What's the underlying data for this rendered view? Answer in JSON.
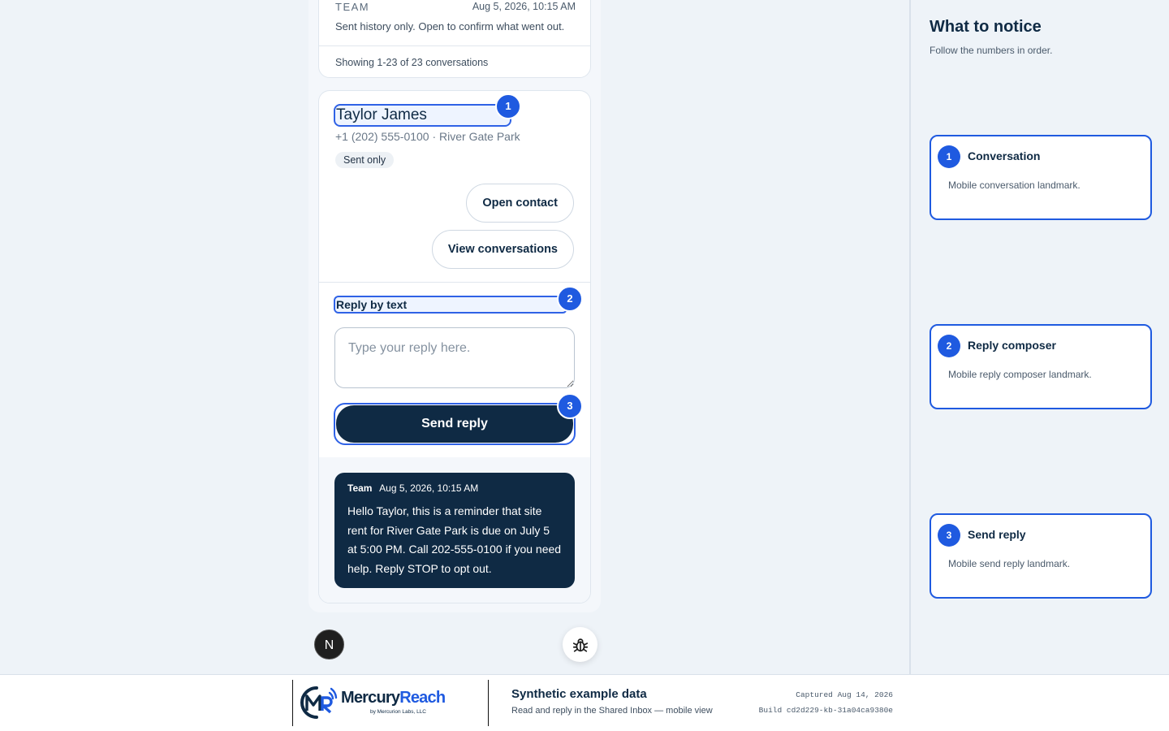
{
  "top_card": {
    "sender": "TEAM",
    "timestamp": "Aug 5, 2026, 10:15 AM",
    "preview": "Sent history only. Open to confirm what went out.",
    "count_text": "Showing 1-23 of 23 conversations"
  },
  "conversation": {
    "contact_name": "Taylor James",
    "contact_meta": "+1 (202) 555-0100 · River Gate Park",
    "status_pill": "Sent only",
    "open_contact_label": "Open contact",
    "view_conversations_label": "View conversations"
  },
  "composer": {
    "label": "Reply by text",
    "placeholder": "Type your reply here.",
    "value": "",
    "send_label": "Send reply"
  },
  "message": {
    "author": "Team",
    "timestamp": "Aug 5, 2026, 10:15 AM",
    "text": "Hello Taylor, this is a reminder that site rent for River Gate Park is due on July 5 at 5:00 PM. Call 202-555-0100 if you need help. Reply STOP to opt out."
  },
  "markers": [
    "1",
    "2",
    "3"
  ],
  "fabs": {
    "left_glyph": "N",
    "left_icon": "nextjs-icon",
    "right_icon": "bug-icon"
  },
  "panel": {
    "title": "What to notice",
    "subtitle": "Follow the numbers in order.",
    "notes": [
      {
        "num": "1",
        "title": "Conversation",
        "body": "Mobile conversation landmark."
      },
      {
        "num": "2",
        "title": "Reply composer",
        "body": "Mobile reply composer landmark."
      },
      {
        "num": "3",
        "title": "Send reply",
        "body": "Mobile send reply landmark."
      }
    ]
  },
  "footer": {
    "brand_part1": "Mercury",
    "brand_part2": "Reach",
    "brand_sub": "by Mercurion Labs, LLC",
    "title": "Synthetic example data",
    "subtitle": "Read and reply in the Shared Inbox — mobile view",
    "captured": "Captured Aug 14, 2026",
    "build": "Build cd2d229-kb-31a04ca9380e"
  },
  "colors": {
    "accent": "#1f5ae0",
    "navy": "#0f2a44",
    "page_bg": "#eef3f8"
  }
}
